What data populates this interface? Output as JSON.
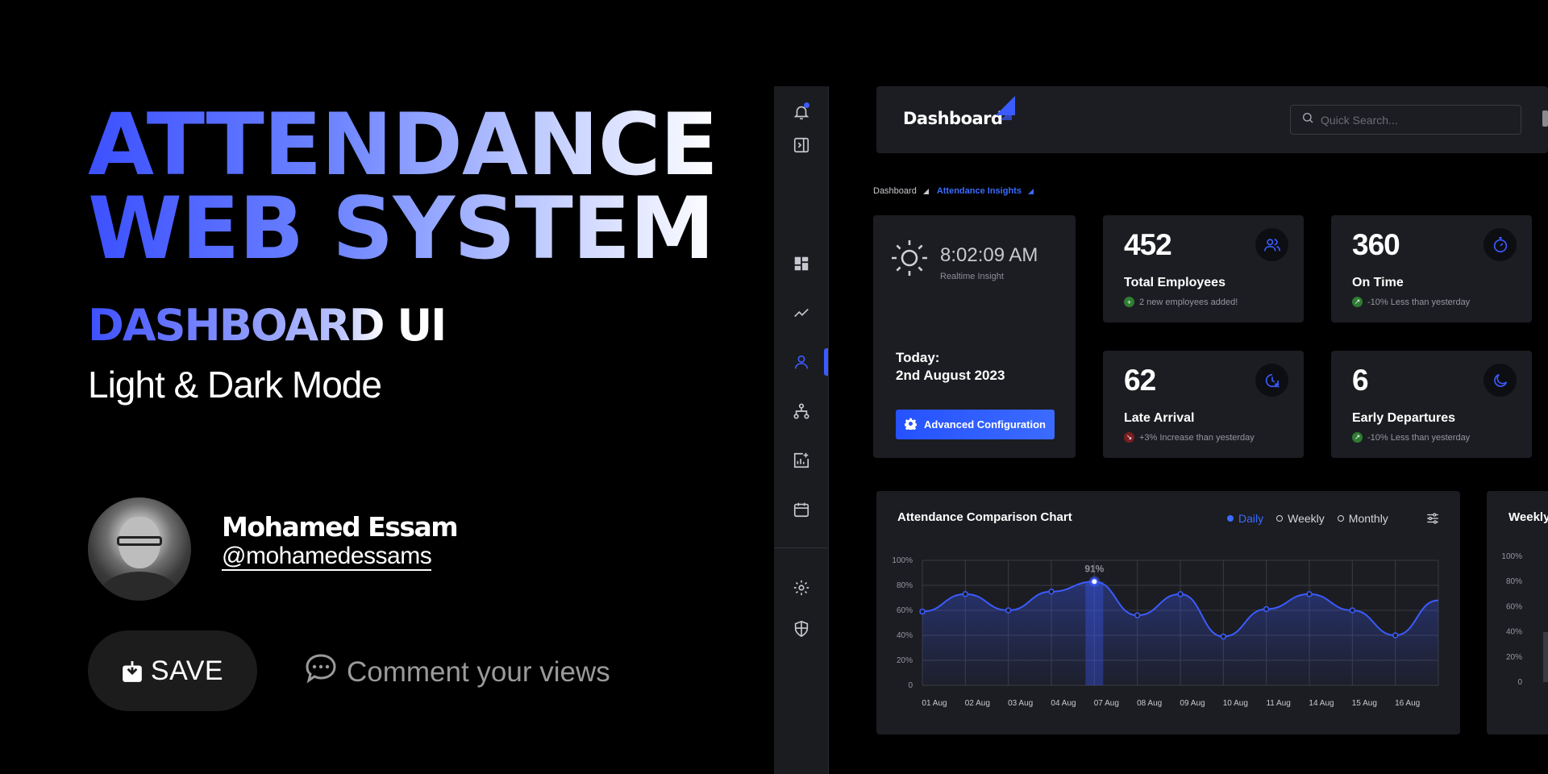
{
  "promo": {
    "title_line1": "ATTENDANCE",
    "title_line2": "WEB SYSTEM",
    "subtitle_a": "DASHBOARD",
    "subtitle_b": " UI",
    "mode": "Light & Dark Mode",
    "author_name": "Mohamed Essam",
    "author_handle": "@mohamedessams",
    "save_label": "SAVE",
    "comment_label": "Comment your views"
  },
  "colors": {
    "accent": "#3b5bff",
    "panel": "#1c1d22",
    "rail": "#1b1c20",
    "positive": "#2e7d32",
    "negative": "#7a1f1f"
  },
  "sidebar": {
    "icons": [
      "bell-icon",
      "panel-toggle-icon",
      "dashboard-grid-icon",
      "trend-line-icon",
      "user-icon",
      "org-chart-icon",
      "report-add-icon",
      "calendar-icon",
      "gear-icon",
      "shield-icon"
    ],
    "active": "user-icon"
  },
  "topbar": {
    "brand": "Dashboard",
    "search_placeholder": "Quick Search..."
  },
  "breadcrumb": {
    "root": "Dashboard",
    "current": "Attendance Insights"
  },
  "time_card": {
    "time": "8:02:09 AM",
    "subtitle": "Realtime Insight",
    "today_label": "Today:",
    "date": "2nd August 2023",
    "config_button": "Advanced Configuration"
  },
  "stats": [
    {
      "value": "452",
      "label": "Total Employees",
      "note": "2 new employees added!",
      "trend": "up",
      "icon": "users-icon"
    },
    {
      "value": "360",
      "label": "On Time",
      "note": "-10% Less than yesterday",
      "trend": "up",
      "icon": "stopwatch-icon"
    },
    {
      "value": "62",
      "label": "Late Arrival",
      "note": "+3% Increase than yesterday",
      "trend": "down",
      "icon": "clock-x-icon"
    },
    {
      "value": "6",
      "label": "Early Departures",
      "note": "-10% Less than yesterday",
      "trend": "up",
      "icon": "moon-icon"
    }
  ],
  "attendance_chart": {
    "title": "Attendance Comparison Chart",
    "options": [
      "Daily",
      "Weekly",
      "Monthly"
    ],
    "selected": "Daily",
    "highlight_label": "91%"
  },
  "weekly_chart": {
    "title": "Weekly",
    "y_ticks": [
      "100%",
      "80%",
      "60%",
      "40%",
      "20%",
      "0"
    ]
  },
  "chart_data": [
    {
      "type": "area",
      "title": "Attendance Comparison Chart",
      "categories": [
        "01 Aug",
        "02 Aug",
        "03 Aug",
        "04 Aug",
        "07 Aug",
        "08 Aug",
        "09 Aug",
        "10 Aug",
        "11 Aug",
        "14 Aug",
        "15 Aug",
        "16 Aug"
      ],
      "y_ticks": [
        "100%",
        "80%",
        "60%",
        "40%",
        "20%",
        "0"
      ],
      "ylim": [
        0,
        100
      ],
      "series": [
        {
          "values": [
            59,
            73,
            60,
            75,
            83,
            56,
            73,
            39,
            61,
            73,
            60,
            40
          ]
        }
      ],
      "end_value": 68,
      "highlight_index": 4,
      "highlight_label": "91%",
      "grid": true
    }
  ]
}
